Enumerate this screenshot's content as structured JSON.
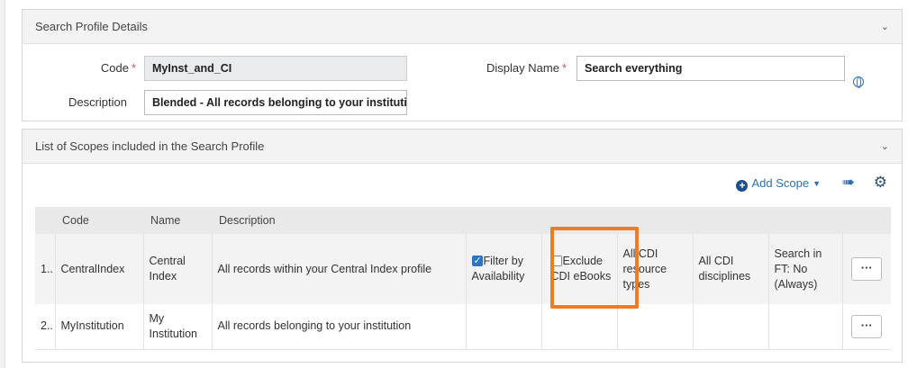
{
  "details": {
    "title": "Search Profile Details",
    "code_label": "Code",
    "code_value": "MyInst_and_CI",
    "display_name_label": "Display Name",
    "display_name_value": "Search everything",
    "description_label": "Description",
    "description_value": "Blended - All records belonging to your institution",
    "required_marker": "*"
  },
  "scopes": {
    "title": "List of Scopes included in the Search Profile",
    "add_scope_label": "Add Scope",
    "columns": [
      "Code",
      "Name",
      "Description"
    ],
    "rows": [
      {
        "num": "1..",
        "code": "CentralIndex",
        "name": "Central Index",
        "description": "All records within your Central Index profile",
        "filter_label": "Filter by Availability",
        "filter_checked": true,
        "exclude_label": "Exclude CDI eBooks",
        "exclude_checked": false,
        "resource_types": "All CDI resource types",
        "disciplines": "All CDI disciplines",
        "search_ft": "Search in FT: No (Always)",
        "actions_label": "···"
      },
      {
        "num": "2..",
        "code": "MyInstitution",
        "name": "My Institution",
        "description": "All records belonging to your institution",
        "actions_label": "···"
      }
    ]
  },
  "colors": {
    "accent": "#2f6fb3",
    "highlight": "#ef7c22",
    "required": "#d9534f"
  },
  "icons": [
    "chevron-down-icon",
    "globe-icon",
    "plus-circle-icon",
    "export-icon",
    "gear-icon",
    "checkbox-icon"
  ]
}
